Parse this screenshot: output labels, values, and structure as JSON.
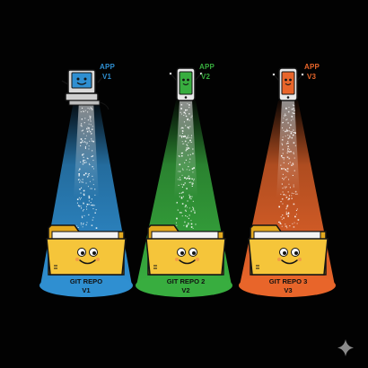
{
  "colors": {
    "background": "#020202",
    "blue": "#2f8fd1",
    "green": "#38ad3f",
    "orange": "#e8652a",
    "folder": "#f5c53a",
    "folder_dark": "#e3a91f",
    "outline": "#141414"
  },
  "columns": [
    {
      "app_line1": "APP",
      "app_line2": "V1",
      "repo_line1": "GIT REPO",
      "repo_line2": "V1",
      "color": "#2f8fd1",
      "device_icon": "retro-computer-icon"
    },
    {
      "app_line1": "APP",
      "app_line2": "V2",
      "repo_line1": "GIT REPO 2",
      "repo_line2": "V2",
      "color": "#38ad3f",
      "device_icon": "smartphone-icon"
    },
    {
      "app_line1": "APP",
      "app_line2": "V3",
      "repo_line1": "GIT REPO 3",
      "repo_line2": "V3",
      "color": "#e8652a",
      "device_icon": "smartphone-icon"
    }
  ],
  "watermark_icon": "sparkle-icon"
}
